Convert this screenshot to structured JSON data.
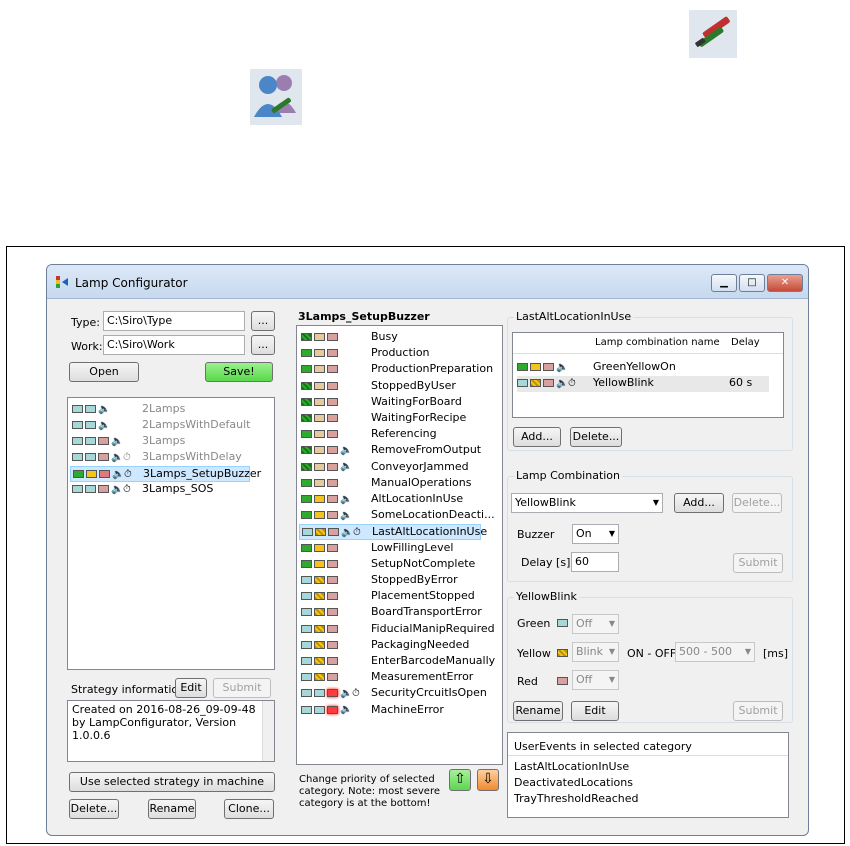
{
  "window": {
    "title": "Lamp Configurator"
  },
  "left": {
    "type_label": "Type:",
    "type_value": "C:\\Siro\\Type",
    "work_label": "Work:",
    "work_value": "C:\\Siro\\Work",
    "browse": "...",
    "open": "Open",
    "save": "Save!",
    "strategies": [
      {
        "name": "2Lamps",
        "lamps": [
          "go",
          "go"
        ],
        "icons": [
          "speaker"
        ],
        "gray": true
      },
      {
        "name": "2LampsWithDefault",
        "lamps": [
          "go",
          "go"
        ],
        "icons": [
          "speaker"
        ],
        "gray": true
      },
      {
        "name": "3Lamps",
        "lamps": [
          "go",
          "go",
          "ro"
        ],
        "icons": [
          "speaker"
        ],
        "gray": true
      },
      {
        "name": "3LampsWithDelay",
        "lamps": [
          "go",
          "go",
          "ro"
        ],
        "icons": [
          "speaker",
          "clock"
        ],
        "gray": true
      },
      {
        "name": "3Lamps_SetupBuzzer",
        "lamps": [
          "g",
          "y",
          "r"
        ],
        "icons": [
          "speaker",
          "clock"
        ],
        "gray": false,
        "selected": true
      },
      {
        "name": "3Lamps_SOS",
        "lamps": [
          "go",
          "go",
          "ro"
        ],
        "icons": [
          "speaker",
          "clock"
        ],
        "gray": false
      }
    ],
    "strategy_info_label": "Strategy information",
    "edit": "Edit",
    "submit": "Submit",
    "info_text": "Created on 2016-08-26_09-09-48 by LampConfigurator, Version 1.0.0.6",
    "use_strategy": "Use selected strategy in machine",
    "delete": "Delete...",
    "rename": "Rename",
    "clone": "Clone..."
  },
  "middle": {
    "title": "3Lamps_SetupBuzzer",
    "categories": [
      {
        "name": "Busy",
        "lamps": [
          "gblink",
          "yo",
          "ro"
        ],
        "icons": []
      },
      {
        "name": "Production",
        "lamps": [
          "g",
          "yo",
          "ro"
        ],
        "icons": []
      },
      {
        "name": "ProductionPreparation",
        "lamps": [
          "g",
          "yo",
          "ro"
        ],
        "icons": []
      },
      {
        "name": "StoppedByUser",
        "lamps": [
          "gblink",
          "yo",
          "ro"
        ],
        "icons": []
      },
      {
        "name": "WaitingForBoard",
        "lamps": [
          "gblink",
          "yo",
          "ro"
        ],
        "icons": []
      },
      {
        "name": "WaitingForRecipe",
        "lamps": [
          "gblink",
          "yo",
          "ro"
        ],
        "icons": []
      },
      {
        "name": "Referencing",
        "lamps": [
          "g",
          "yo",
          "ro"
        ],
        "icons": []
      },
      {
        "name": "RemoveFromOutput",
        "lamps": [
          "gblink",
          "yo",
          "ro"
        ],
        "icons": [
          "speaker"
        ]
      },
      {
        "name": "ConveyorJammed",
        "lamps": [
          "gblink",
          "yo",
          "ro"
        ],
        "icons": [
          "speaker"
        ]
      },
      {
        "name": "ManualOperations",
        "lamps": [
          "g",
          "yo",
          "ro"
        ],
        "icons": []
      },
      {
        "name": "AltLocationInUse",
        "lamps": [
          "g",
          "y",
          "ro"
        ],
        "icons": [
          "speaker"
        ]
      },
      {
        "name": "SomeLocationDeacti...",
        "lamps": [
          "g",
          "y",
          "ro"
        ],
        "icons": [
          "speaker"
        ]
      },
      {
        "name": "LastAltLocationInUse",
        "lamps": [
          "go",
          "blink",
          "ro"
        ],
        "icons": [
          "speaker",
          "clock"
        ],
        "selected": true
      },
      {
        "name": "LowFillingLevel",
        "lamps": [
          "g",
          "y",
          "ro"
        ],
        "icons": []
      },
      {
        "name": "SetupNotComplete",
        "lamps": [
          "g",
          "y",
          "ro"
        ],
        "icons": []
      },
      {
        "name": "StoppedByError",
        "lamps": [
          "go",
          "blink",
          "ro"
        ],
        "icons": []
      },
      {
        "name": "PlacementStopped",
        "lamps": [
          "go",
          "blink",
          "ro"
        ],
        "icons": []
      },
      {
        "name": "BoardTransportError",
        "lamps": [
          "go",
          "blink",
          "ro"
        ],
        "icons": []
      },
      {
        "name": "FiducialManipRequired",
        "lamps": [
          "go",
          "blink",
          "ro"
        ],
        "icons": []
      },
      {
        "name": "PackagingNeeded",
        "lamps": [
          "go",
          "blink",
          "ro"
        ],
        "icons": []
      },
      {
        "name": "EnterBarcodeManually",
        "lamps": [
          "go",
          "blink",
          "ro"
        ],
        "icons": []
      },
      {
        "name": "MeasurementError",
        "lamps": [
          "go",
          "blink",
          "ro"
        ],
        "icons": []
      },
      {
        "name": "SecurityCrcuitIsOpen",
        "lamps": [
          "go",
          "go",
          "rblink"
        ],
        "icons": [
          "speaker",
          "clock"
        ]
      },
      {
        "name": "MachineError",
        "lamps": [
          "go",
          "go",
          "rblink"
        ],
        "icons": [
          "speaker"
        ]
      }
    ],
    "priority_note": "Change priority of selected category. Note: most severe category is at the bottom!"
  },
  "right": {
    "alt_group_title": "LastAltLocationInUse",
    "col_name": "Lamp combination name",
    "col_delay": "Delay",
    "combos": [
      {
        "name": "GreenYellowOn",
        "delay": "",
        "lamps": [
          "g",
          "y",
          "ro"
        ],
        "icons": [
          "speaker"
        ]
      },
      {
        "name": "YellowBlink",
        "delay": "60 s",
        "lamps": [
          "go",
          "blink",
          "ro"
        ],
        "icons": [
          "speaker",
          "clock"
        ]
      }
    ],
    "add": "Add...",
    "delete": "Delete...",
    "lc_group_title": "Lamp Combination",
    "lc_selected": "YellowBlink",
    "buzzer_label": "Buzzer",
    "buzzer_value": "On",
    "delay_label": "Delay [s]",
    "delay_value": "60",
    "submit": "Submit",
    "yb_group_title": "YellowBlink",
    "green_label": "Green",
    "green_value": "Off",
    "yellow_label": "Yellow",
    "yellow_value": "Blink",
    "onoff_label": "ON - OFF",
    "onoff_value": "500 - 500",
    "ms_label": "[ms]",
    "red_label": "Red",
    "red_value": "Off",
    "rename": "Rename",
    "edit": "Edit",
    "user_events_title": "UserEvents in selected category",
    "user_events": [
      "LastAltLocationInUse",
      "DeactivatedLocations",
      "TrayThresholdReached"
    ]
  }
}
